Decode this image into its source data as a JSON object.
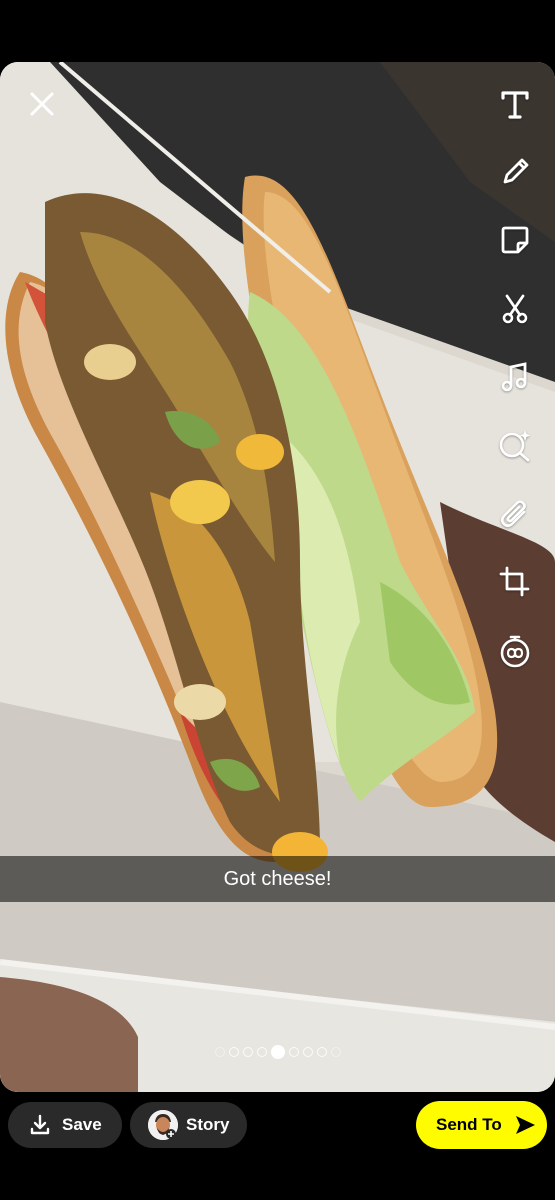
{
  "editor": {
    "caption": "Got cheese!",
    "icons": [
      "close-icon",
      "text-icon",
      "pencil-icon",
      "sticker-icon",
      "scissors-icon",
      "music-icon",
      "lens-icon",
      "paperclip-icon",
      "crop-icon",
      "timer-icon"
    ],
    "page_dots": {
      "count": 9,
      "active_index": 4
    }
  },
  "bottom_bar": {
    "save_label": "Save",
    "story_label": "Story",
    "send_label": "Send To"
  },
  "colors": {
    "accent": "#fffc00",
    "pill": "#2a2a2a"
  }
}
